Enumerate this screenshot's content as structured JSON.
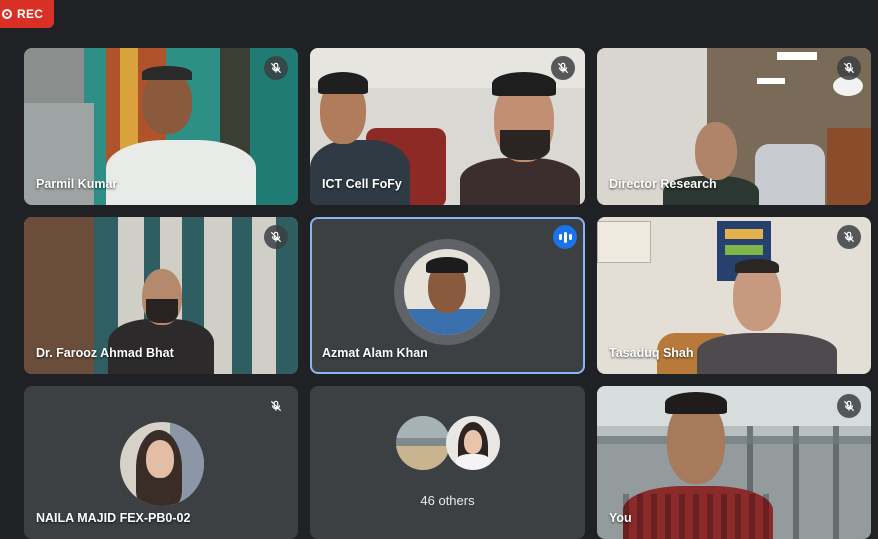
{
  "recording": {
    "label": "REC"
  },
  "participants": [
    {
      "name": "Parmil Kumar",
      "muted": true
    },
    {
      "name": "ICT Cell FoFy",
      "muted": true
    },
    {
      "name": "Director Research",
      "muted": true
    },
    {
      "name": "Dr. Farooz Ahmad Bhat",
      "muted": true
    },
    {
      "name": "Azmat Alam Khan",
      "muted": false,
      "speaking": true
    },
    {
      "name": "Tasaduq Shah",
      "muted": true
    },
    {
      "name": "NAILA MAJID FEX-PB0-02",
      "muted": true
    },
    {
      "name": "46 others"
    },
    {
      "name": "You",
      "muted": true
    }
  ],
  "colors": {
    "background": "#202124",
    "tile": "#3c4043",
    "active_border": "#8ab4f8",
    "rec": "#d93025",
    "speaking": "#1a73e8"
  },
  "icons": {
    "mute": "mic-off-icon",
    "speaking": "audio-level-icon",
    "record": "record-icon"
  }
}
